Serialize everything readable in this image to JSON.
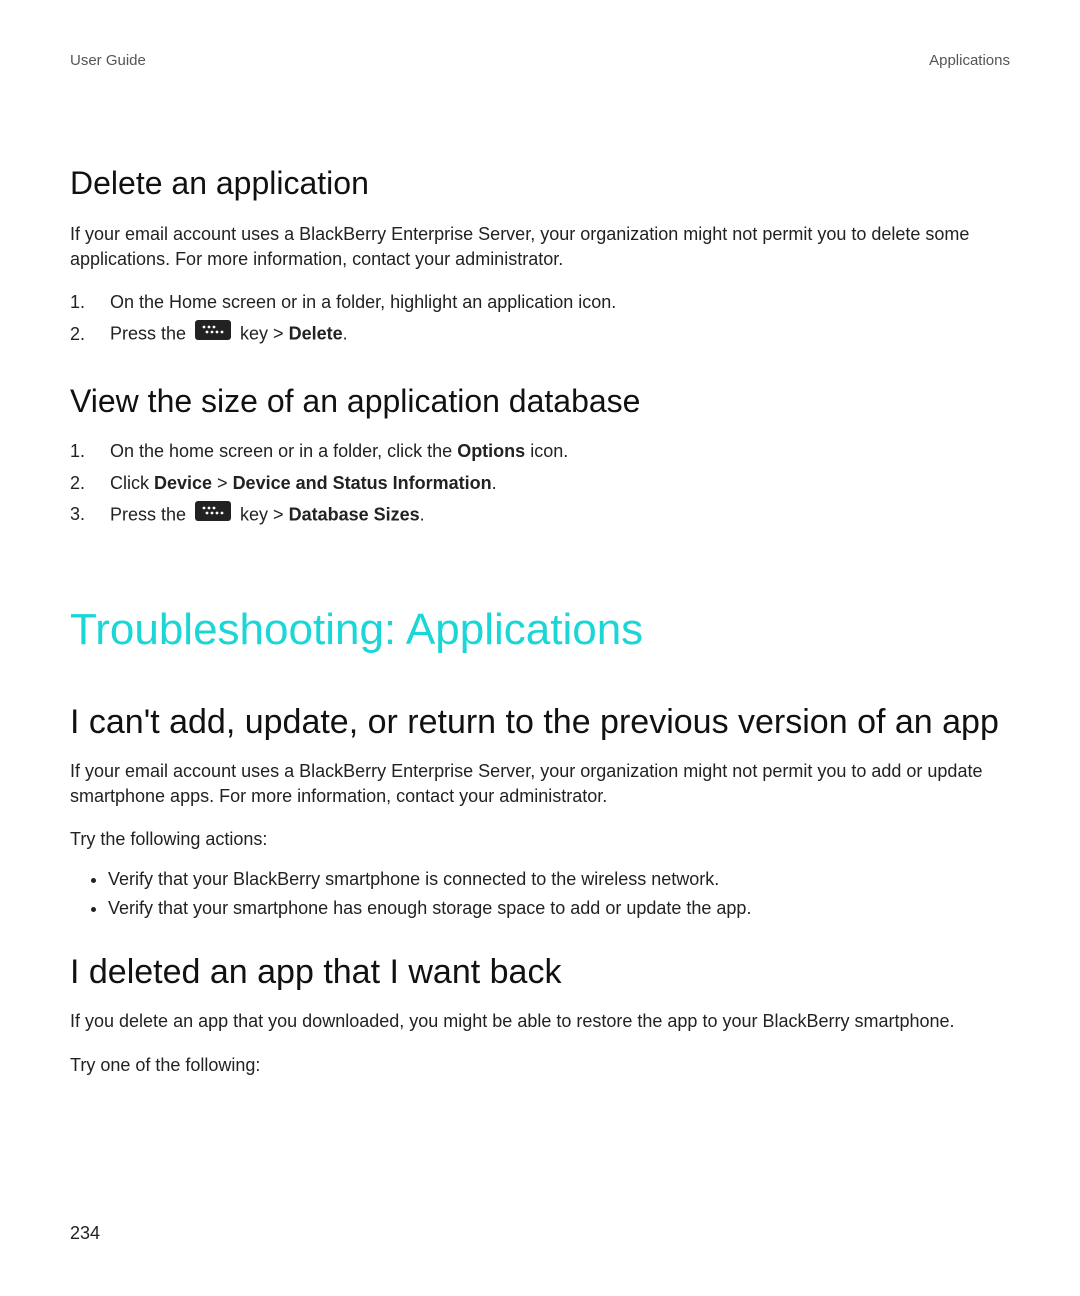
{
  "header": {
    "left": "User Guide",
    "right": "Applications"
  },
  "sections": {
    "delete_app": {
      "title": "Delete an application",
      "para": "If your email account uses a BlackBerry Enterprise Server, your organization might not permit you to delete some applications. For more information, contact your administrator.",
      "steps": {
        "s1": "On the Home screen or in a folder, highlight an application icon.",
        "s2a": "Press the ",
        "s2b": " key > ",
        "s2c": "Delete",
        "s2d": "."
      }
    },
    "view_db": {
      "title": "View the size of an application database",
      "steps": {
        "s1a": "On the home screen or in a folder, click the ",
        "s1b": "Options",
        "s1c": " icon.",
        "s2a": "Click ",
        "s2b": "Device",
        "s2c": " > ",
        "s2d": "Device and Status Information",
        "s2e": ".",
        "s3a": "Press the ",
        "s3b": " key > ",
        "s3c": "Database Sizes",
        "s3d": "."
      }
    },
    "troubleshoot_title": "Troubleshooting: Applications",
    "cant_add": {
      "title": "I can't add, update, or return to the previous version of an app",
      "para": "If your email account uses a BlackBerry Enterprise Server, your organization might not permit you to add or update smartphone apps. For more information, contact your administrator.",
      "try": "Try the following actions:",
      "bullets": {
        "b1": "Verify that your BlackBerry smartphone is connected to the wireless network.",
        "b2": "Verify that your smartphone has enough storage space to add or update the app."
      }
    },
    "deleted_app": {
      "title": "I deleted an app that I want back",
      "para": "If you delete an app that you downloaded, you might be able to restore the app to your BlackBerry smartphone.",
      "try": "Try one of the following:"
    }
  },
  "page_number": "234"
}
